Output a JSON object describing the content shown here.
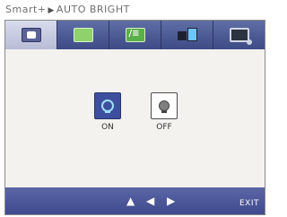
{
  "breadcrumb": {
    "menu": "Smart+",
    "submenu": "AUTO BRIGHT"
  },
  "tabs": [
    {
      "icon": "picture-icon"
    },
    {
      "icon": "color-icon"
    },
    {
      "icon": "tracking-icon"
    },
    {
      "icon": "setup-icon"
    },
    {
      "icon": "monitor-icon"
    }
  ],
  "options": [
    {
      "label": "ON",
      "icon": "bulb-on-icon",
      "selected": true
    },
    {
      "label": "OFF",
      "icon": "bulb-off-icon",
      "selected": false
    }
  ],
  "footer": {
    "up": "▲",
    "left": "◀",
    "right": "▶",
    "exit": "EXIT"
  },
  "colors": {
    "accent": "#3d4f9e",
    "tab_bar": "#4a5690"
  }
}
